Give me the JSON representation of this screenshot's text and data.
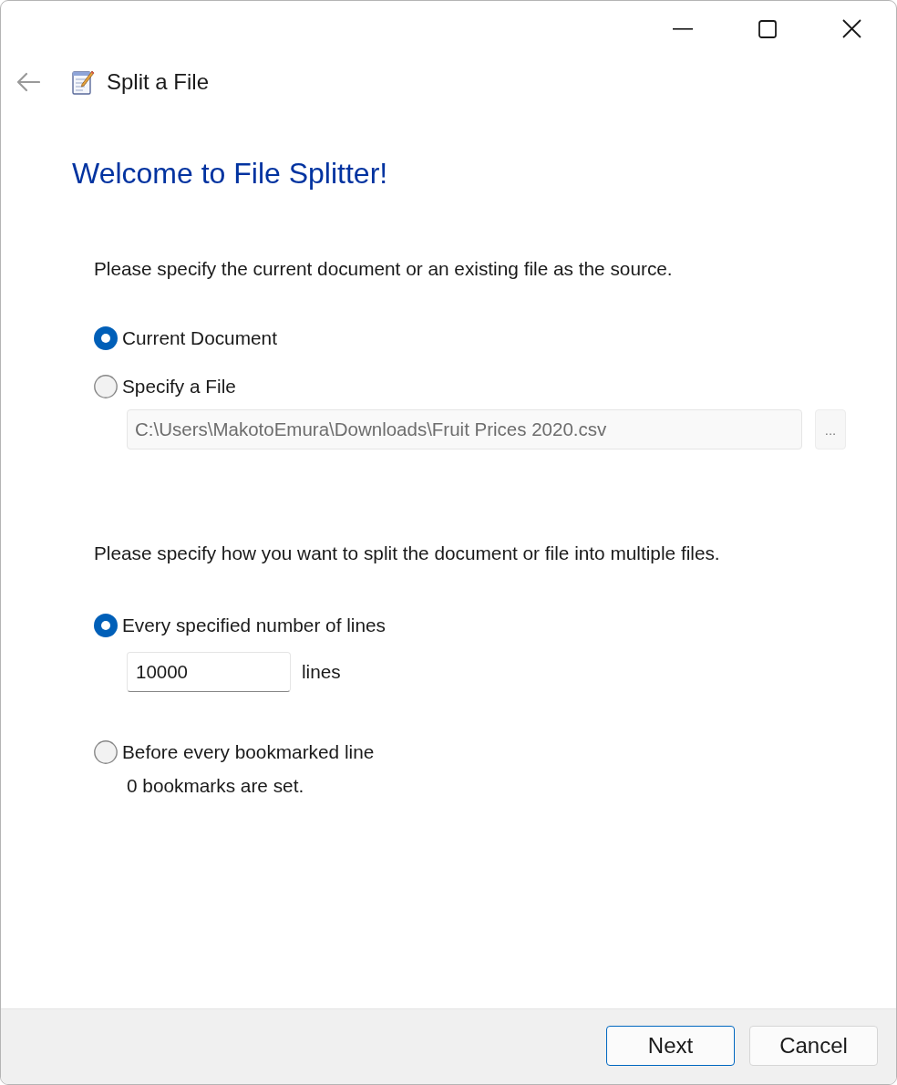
{
  "window": {
    "title": "Split a File"
  },
  "back_button": {
    "disabled": true
  },
  "heading": "Welcome to File Splitter!",
  "source": {
    "prompt": "Please specify the current document or an existing file as the source.",
    "options": [
      {
        "label": "Current Document",
        "selected": true
      },
      {
        "label": "Specify a File",
        "selected": false
      }
    ],
    "file_path": {
      "value": "C:\\Users\\MakotoEmura\\Downloads\\Fruit Prices 2020.csv",
      "disabled": true
    },
    "browse_button": {
      "label": "...",
      "disabled": true
    }
  },
  "split": {
    "prompt": "Please specify how you want to split the document or file into multiple files.",
    "options": [
      {
        "kind": "lines",
        "label": "Every specified number of lines",
        "selected": true,
        "value": "10000",
        "unit": "lines"
      },
      {
        "kind": "bookmarks",
        "label": "Before every bookmarked line",
        "selected": false,
        "note": "0 bookmarks are set."
      }
    ]
  },
  "buttons": [
    {
      "label": "Next",
      "default": true
    },
    {
      "label": "Cancel",
      "default": false
    }
  ]
}
